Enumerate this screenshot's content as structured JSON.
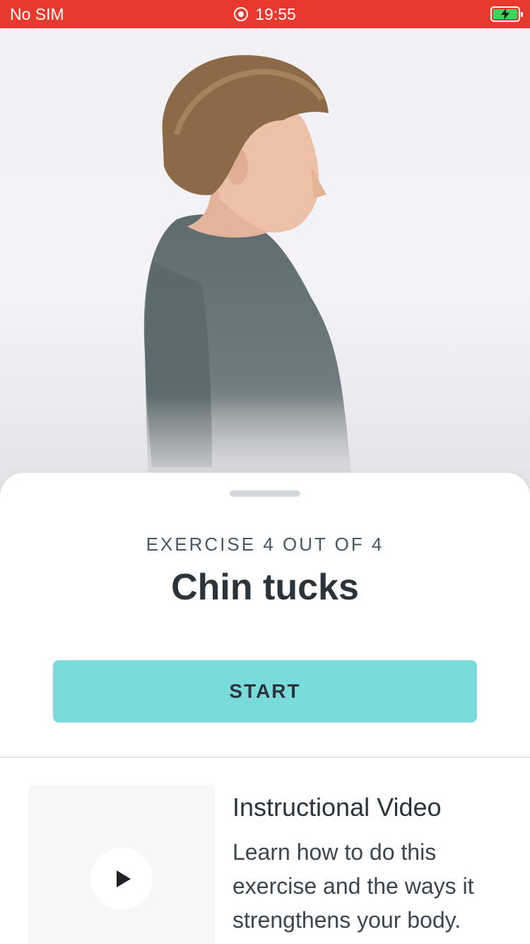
{
  "status_bar": {
    "carrier": "No SIM",
    "time": "19:55",
    "icons": [
      "screen-record-icon",
      "battery-charging-icon"
    ],
    "color": "#e8392f"
  },
  "hero": {
    "image": "man-in-grey-tshirt-side-profile"
  },
  "sheet": {
    "counter": "EXERCISE 4 OUT OF 4",
    "exercise_current": 4,
    "exercise_total": 4,
    "title": "Chin tucks",
    "start_label": "START",
    "accent": "#79dbdb"
  },
  "video": {
    "title": "Instructional Video",
    "description": "Learn how to do this exercise and the ways it strengthens your body.",
    "icon": "play-icon"
  }
}
